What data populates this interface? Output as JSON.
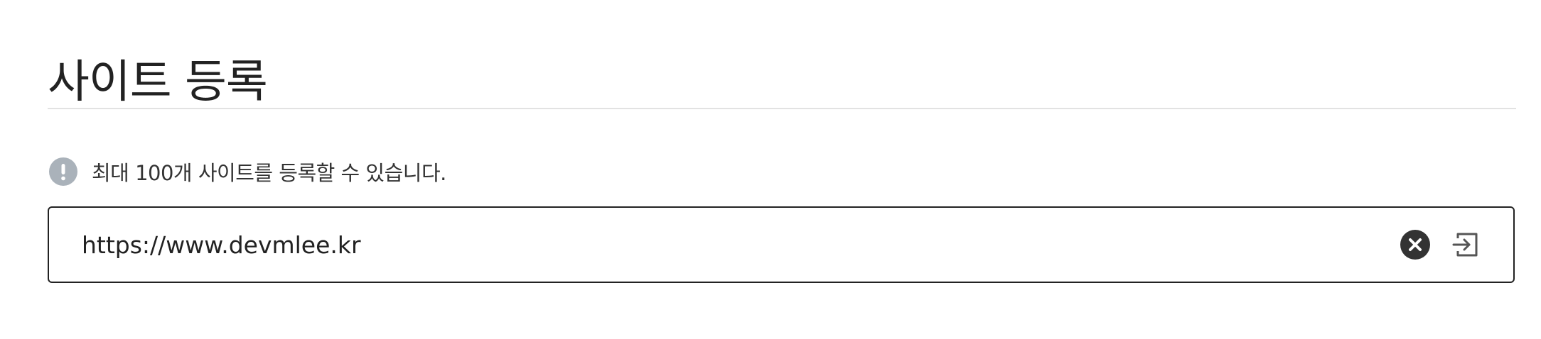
{
  "page": {
    "title": "사이트 등록"
  },
  "notice": {
    "icon": "exclamation-circle-icon",
    "icon_color": "#aab2ba",
    "text": "최대 100개 사이트를 등록할 수 있습니다."
  },
  "url_field": {
    "value": "https://www.devmlee.kr",
    "clear_icon": "close-circle-icon",
    "submit_icon": "enter-arrow-icon",
    "border_color": "#222222"
  }
}
